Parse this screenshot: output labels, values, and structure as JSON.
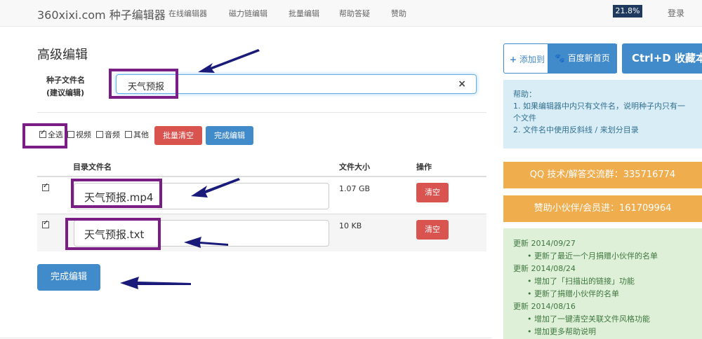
{
  "navbar": {
    "brand": "360xixi.com 种子编辑器",
    "links": [
      "在线编辑器",
      "磁力链编辑",
      "批量编辑",
      "帮助答疑",
      "赞助"
    ],
    "badge": "21.8%",
    "login": "登录"
  },
  "editor": {
    "title": "高级编辑",
    "name_label_line1": "种子文件名",
    "name_label_line2": "(建议编辑)",
    "name_value": "天气预报",
    "clear_symbol": "×",
    "filters": {
      "all": "全选",
      "video": "视频",
      "audio": "音频",
      "other": "其他"
    },
    "batch_clear": "批量清空",
    "finish_edit": "完成编辑",
    "columns": [
      "目录文件名",
      "文件大小",
      "操作"
    ],
    "files": [
      {
        "name": "天气预报.mp4",
        "size": "1.07 GB",
        "action": "清空",
        "checked": true
      },
      {
        "name": "天气预报.txt",
        "size": "10 KB",
        "action": "清空",
        "checked": true
      }
    ],
    "finish_big": "完成编辑"
  },
  "sidebar": {
    "add_to": "添加到",
    "baidu": "百度新首页",
    "ctrl_d": "Ctrl+D 收藏本站",
    "help_title": "帮助：",
    "help_lines": [
      "1. 如果编辑器中内只有文件名，说明种子内只有一个文件",
      "2. 文件名中使用反斜线 / 来划分目录"
    ],
    "qq": "QQ 技术/解答交流群：335716774",
    "sponsor": "赞助小伙伴/会员进：161709964",
    "news": [
      {
        "date": "更新 2014/09/27",
        "items": [
          "更新了最近一个月捐赠小伙伴的名单"
        ]
      },
      {
        "date": "更新 2014/08/24",
        "items": [
          "增加了「扫描出的链接」功能",
          "更新了捐赠小伙伴的名单"
        ]
      },
      {
        "date": "更新 2014/08/16",
        "items": [
          "增加了一键清空关联文件风格功能",
          "增加更多帮助说明"
        ]
      }
    ]
  },
  "colors": {
    "highlight": "#7a1e86",
    "arrow": "#1a1a7a",
    "primary": "#428bca",
    "danger": "#d9534f",
    "warning": "#f0ad4e"
  }
}
